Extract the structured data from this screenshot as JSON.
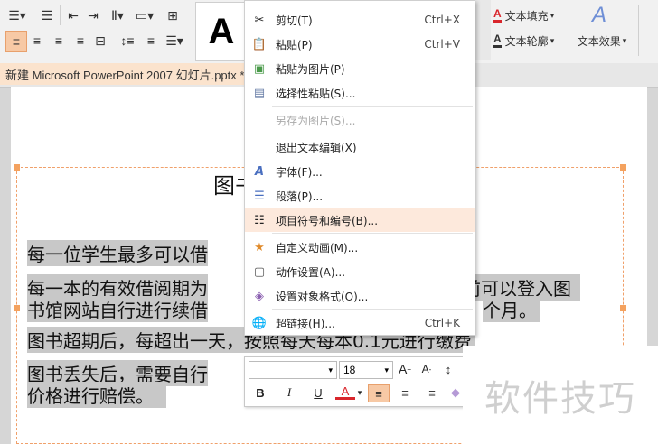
{
  "document": {
    "tab_title": "新建 Microsoft PowerPoint 2007 幻灯片.pptx *"
  },
  "ribbon": {
    "big_text_sample": "A",
    "text_fill": "文本填充",
    "text_outline": "文本轮廓",
    "text_effect": "文本效果"
  },
  "slide": {
    "title": "图书",
    "lines": [
      "每一位学生最多可以借",
      "每一本的有效借阅期为",
      "前可以登入图",
      "书馆网站自行进行续借",
      "个月。",
      "图书超期后，每超出一天，按照每天每本0.1元进行缴费",
      "图书丢失后，需要自行",
      "价格进行赔偿。"
    ]
  },
  "context_menu": {
    "items": [
      {
        "icon": "scissors-icon",
        "label": "剪切(T)",
        "shortcut": "Ctrl+X"
      },
      {
        "icon": "paste-icon",
        "label": "粘贴(P)",
        "shortcut": "Ctrl+V"
      },
      {
        "icon": "paste-as-image-icon",
        "label": "粘贴为图片(P)",
        "shortcut": ""
      },
      {
        "icon": "paste-special-icon",
        "label": "选择性粘贴(S)...",
        "shortcut": ""
      },
      {
        "icon": "",
        "label": "另存为图片(S)...",
        "shortcut": "",
        "disabled": true
      },
      {
        "icon": "",
        "label": "退出文本编辑(X)",
        "shortcut": ""
      },
      {
        "icon": "font-icon",
        "label": "字体(F)...",
        "shortcut": ""
      },
      {
        "icon": "paragraph-icon",
        "label": "段落(P)...",
        "shortcut": ""
      },
      {
        "icon": "bullets-icon",
        "label": "项目符号和编号(B)...",
        "shortcut": ""
      },
      {
        "icon": "custom-animation-icon",
        "label": "自定义动画(M)...",
        "shortcut": ""
      },
      {
        "icon": "action-settings-icon",
        "label": "动作设置(A)...",
        "shortcut": ""
      },
      {
        "icon": "format-object-icon",
        "label": "设置对象格式(O)...",
        "shortcut": ""
      },
      {
        "icon": "hyperlink-icon",
        "label": "超链接(H)...",
        "shortcut": "Ctrl+K"
      }
    ]
  },
  "mini_toolbar": {
    "font_name": "",
    "font_size": "18",
    "bold": "B",
    "italic": "I",
    "underline": "U",
    "font_color": "A"
  },
  "watermark": {
    "text": "软件技巧"
  },
  "colors": {
    "accent": "#f4a25f",
    "highlight": "#c8c8c8",
    "menu_hover": "#fde9dc",
    "red": "#d9262c"
  }
}
